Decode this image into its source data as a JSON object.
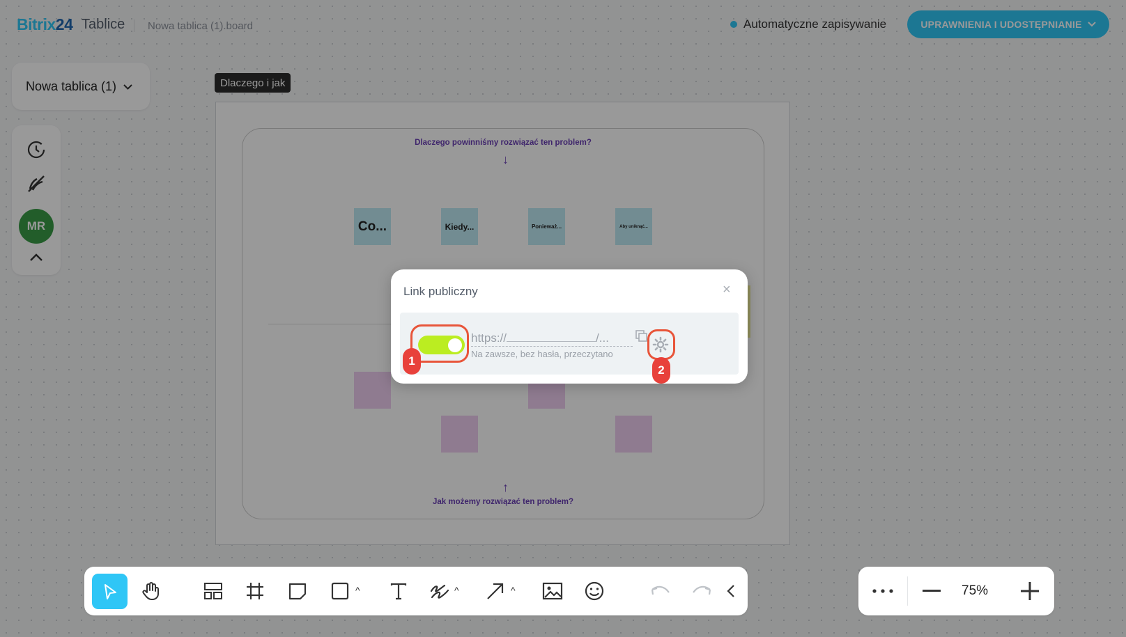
{
  "header": {
    "logo_main": "Bitrix",
    "logo_num": "24",
    "logo_sub": "Tablice",
    "filename": "Nowa tablica (1).board",
    "autosave": "Automatyczne zapisywanie",
    "share_button": "UPRAWNIENIA I UDOSTĘPNIANIE"
  },
  "sidebar": {
    "board_name": "Nowa tablica (1)",
    "avatar_initials": "MR",
    "icons": [
      "history-icon",
      "no-pen-icon",
      "avatar",
      "chevron-up-icon"
    ]
  },
  "board": {
    "frame_label": "Dlaczego i jak",
    "question_top": "Dlaczego powinniśmy rozwiązać ten problem?",
    "question_bottom": "Jak możemy rozwiązać ten problem?",
    "stickies_top": [
      "Co...",
      "Kiedy...",
      "Ponieważ...",
      "Aby uniknąć..."
    ],
    "colors": {
      "sticky_blue": "#bfe9f3",
      "sticky_purple": "#eecdf0",
      "accent": "#2fc6f6"
    }
  },
  "dialog": {
    "title": "Link publiczny",
    "close": "×",
    "toggle_on": true,
    "link_prefix": "https://",
    "link_suffix": "/...",
    "link_subtitle": "Na zawsze, bez hasła, przeczytano",
    "badge_1": "1",
    "badge_2": "2"
  },
  "toolbar": {
    "tools": [
      "select-icon",
      "hand-icon",
      "template-icon",
      "frame-icon",
      "sticky-note-icon",
      "shape-icon",
      "text-icon",
      "pen-icon",
      "arrow-icon",
      "image-icon",
      "emoji-icon",
      "undo-icon",
      "redo-icon",
      "collapse-icon"
    ]
  },
  "zoom": {
    "value": "75%"
  }
}
